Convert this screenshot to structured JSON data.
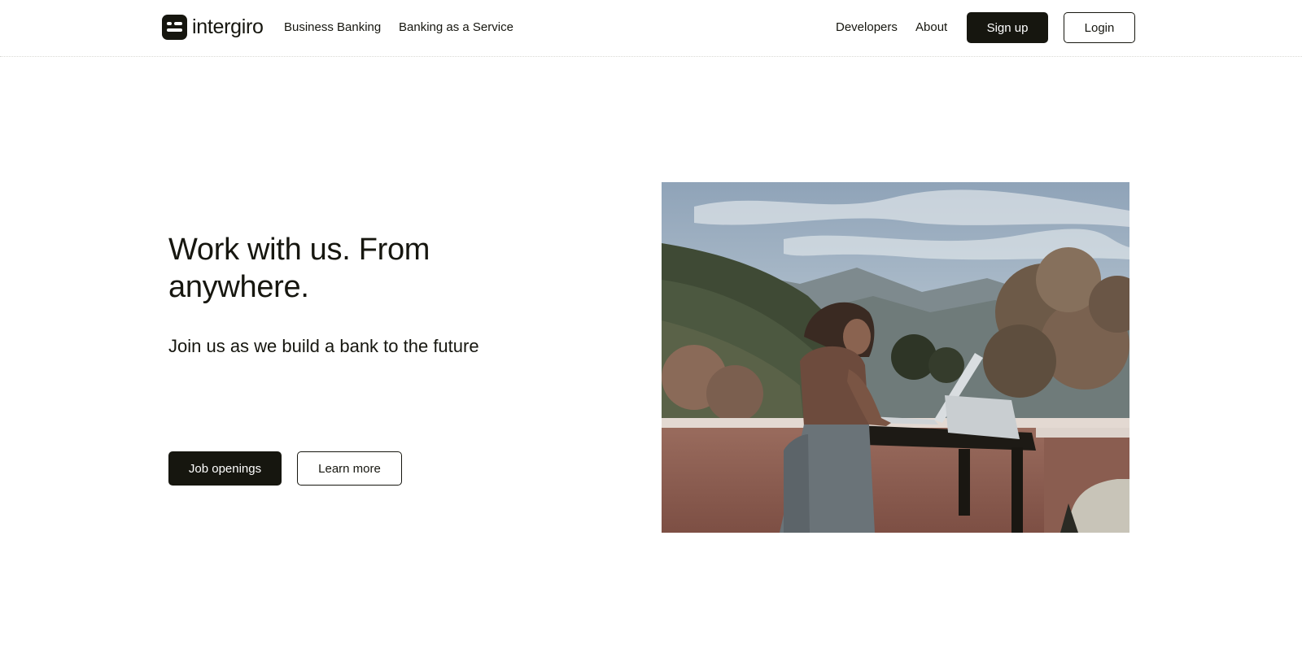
{
  "brand": {
    "name": "intergiro",
    "logo_icon": "intergiro-logo-icon"
  },
  "nav": {
    "business_banking": "Business Banking",
    "baas": "Banking as a Service",
    "developers": "Developers",
    "about": "About",
    "signup": "Sign up",
    "login": "Login"
  },
  "hero": {
    "title": "Work with us. From anywhere.",
    "subtitle": "Join us as we build a bank to the future",
    "primary_button": "Job openings",
    "secondary_button": "Learn more"
  },
  "colors": {
    "ink": "#16160f",
    "background": "#ffffff"
  }
}
